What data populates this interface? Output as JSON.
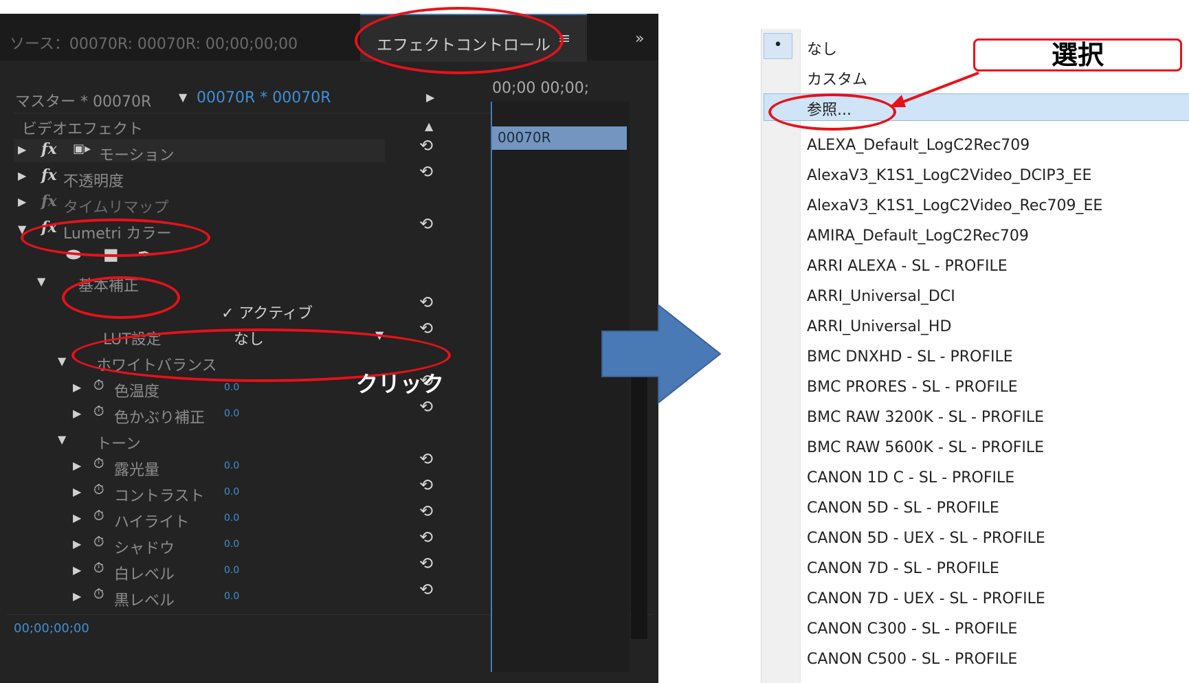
{
  "tabs": {
    "source": "ソース：00070R: 00070R: 00;00;00;00",
    "effect_controls": "エフェクトコントロール",
    "menu": "≡",
    "more": "»"
  },
  "header": {
    "master": "マスター * 00070R",
    "clip": "00070R * 00070R",
    "timecode": "00;00 00;00;",
    "clip_bar": "00070R"
  },
  "video_effects_label": "ビデオエフェクト",
  "effects": [
    {
      "name": "モーション"
    },
    {
      "name": "不透明度"
    },
    {
      "name": "タイムリマップ"
    },
    {
      "name": "Lumetri カラー"
    }
  ],
  "basic_correction": "基本補正",
  "active_label": "✓ アクティブ",
  "lut": {
    "label": "LUT設定",
    "value": "なし"
  },
  "white_balance": "ホワイトバランス",
  "params_wb": [
    {
      "label": "色温度",
      "value": "0.0"
    },
    {
      "label": "色かぶり補正",
      "value": "0.0"
    }
  ],
  "tone": "トーン",
  "params_tone": [
    {
      "label": "露光量",
      "value": "0.0"
    },
    {
      "label": "コントラスト",
      "value": "0.0"
    },
    {
      "label": "ハイライト",
      "value": "0.0"
    },
    {
      "label": "シャドウ",
      "value": "0.0"
    },
    {
      "label": "白レベル",
      "value": "0.0"
    },
    {
      "label": "黒レベル",
      "value": "0.0"
    }
  ],
  "footer_timecode": "00;00;00;00",
  "annotations": {
    "click": "クリック",
    "select": "選択"
  },
  "dropdown": {
    "items": [
      "なし",
      "カスタム",
      "参照...",
      "ALEXA_Default_LogC2Rec709",
      "AlexaV3_K1S1_LogC2Video_DCIP3_EE",
      "AlexaV3_K1S1_LogC2Video_Rec709_EE",
      "AMIRA_Default_LogC2Rec709",
      "ARRI ALEXA - SL - PROFILE",
      "ARRI_Universal_DCI",
      "ARRI_Universal_HD",
      "BMC DNXHD - SL - PROFILE",
      "BMC PRORES - SL - PROFILE",
      "BMC RAW 3200K - SL - PROFILE",
      "BMC RAW 5600K - SL - PROFILE",
      "CANON 1D C - SL - PROFILE",
      "CANON 5D - SL - PROFILE",
      "CANON 5D - UEX - SL - PROFILE",
      "CANON 7D - SL - PROFILE",
      "CANON 7D - UEX - SL - PROFILE",
      "CANON C300 - SL - PROFILE",
      "CANON C500 - SL - PROFILE"
    ],
    "selected_bullet": "•"
  },
  "colors": {
    "annotation_red": "#e8111a",
    "accent_blue": "#3f8fd6",
    "arrow_blue": "#4a7ab5"
  }
}
